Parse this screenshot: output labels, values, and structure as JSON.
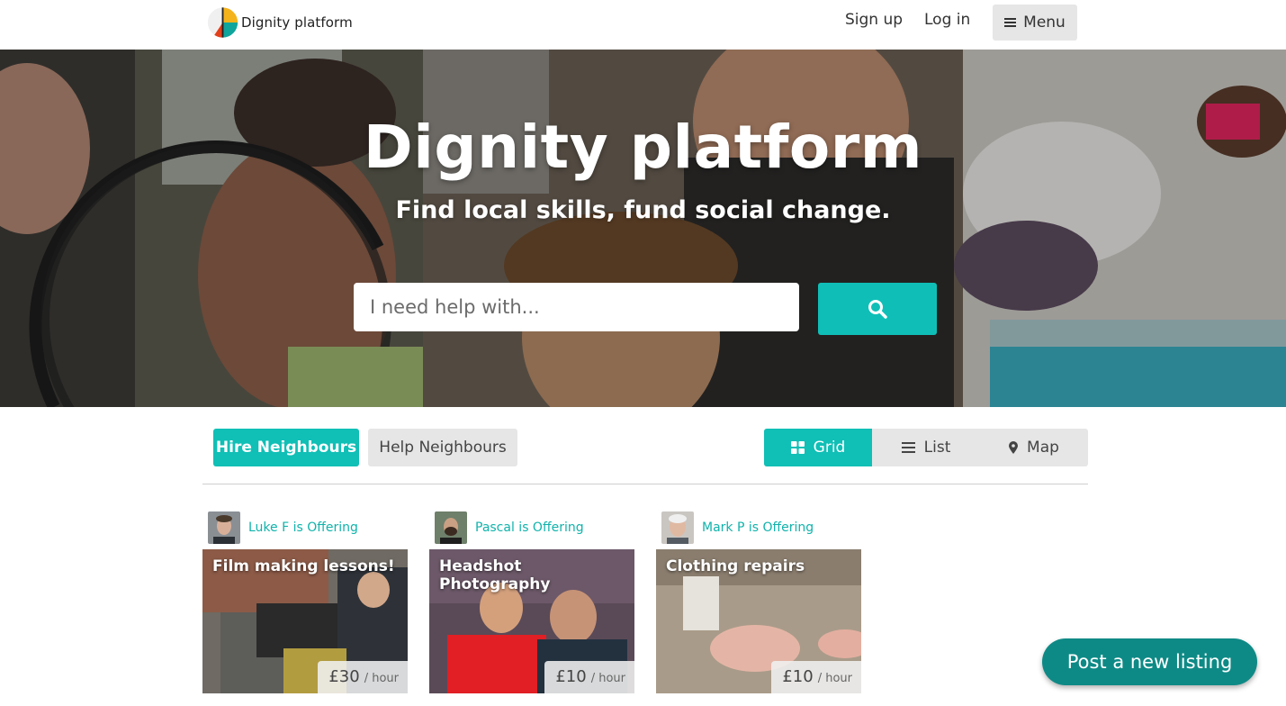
{
  "header": {
    "logo_text": "Dignity platform",
    "signup_label": "Sign up",
    "login_label": "Log in",
    "menu_label": "Menu"
  },
  "hero": {
    "title": "Dignity platform",
    "subtitle": "Find local skills, fund social change.",
    "search_placeholder": "I need help with..."
  },
  "tabs": {
    "hire_label": "Hire Neighbours",
    "help_label": "Help Neighbours",
    "active": "hire"
  },
  "view_modes": [
    {
      "label": "Grid",
      "icon": "grid-icon",
      "active": true
    },
    {
      "label": "List",
      "icon": "list-icon",
      "active": false
    },
    {
      "label": "Map",
      "icon": "map-pin-icon",
      "active": false
    }
  ],
  "listings": [
    {
      "author": "Luke F is Offering",
      "title": "Film making lessons!",
      "price": "£30",
      "unit": "/ hour"
    },
    {
      "author": "Pascal is Offering",
      "title": "Headshot Photography",
      "price": "£10",
      "unit": "/ hour"
    },
    {
      "author": "Mark P is Offering",
      "title": "Clothing repairs",
      "price": "£10",
      "unit": "/ hour"
    }
  ],
  "post_button_label": "Post a new listing",
  "colors": {
    "accent": "#10bfb6",
    "post_button": "#0e8a86",
    "inactive_tab": "#e6e6e6"
  }
}
